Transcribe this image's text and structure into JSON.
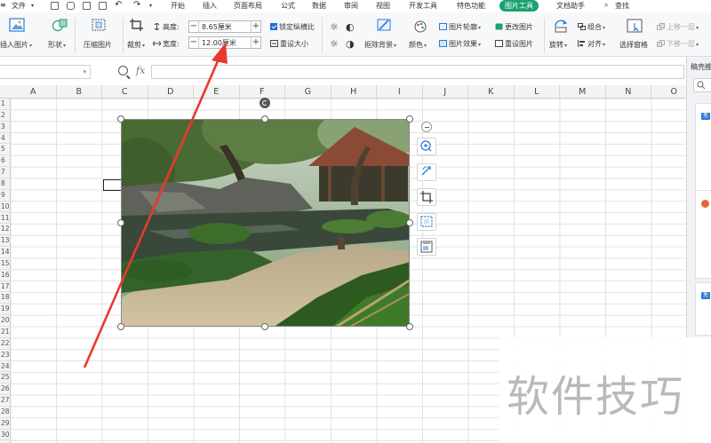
{
  "menubar": {
    "file_label": "文件",
    "tabs": [
      {
        "label": "开始"
      },
      {
        "label": "插入"
      },
      {
        "label": "页面布局"
      },
      {
        "label": "公式"
      },
      {
        "label": "数据"
      },
      {
        "label": "审阅"
      },
      {
        "label": "视图"
      },
      {
        "label": "开发工具"
      },
      {
        "label": "特色功能"
      },
      {
        "label": "图片工具",
        "active": true
      },
      {
        "label": "文档助手"
      }
    ],
    "search_label": "查找"
  },
  "ribbon": {
    "insert_picture": "插入图片",
    "shape": "形状",
    "compress_picture": "压缩图片",
    "crop": "裁剪",
    "height_label": "高度:",
    "height_value": "8.65厘米",
    "width_label": "宽度:",
    "width_value": "12.00厘米",
    "lock_ratio": "锁定纵横比",
    "reset_size": "重设大小",
    "remove_bg": "抠除背景",
    "color": "颜色",
    "picture_outline": "图片轮廓",
    "picture_effect": "图片效果",
    "change_picture": "更改图片",
    "reset_picture": "重设图片",
    "rotate": "旋转",
    "group": "组合",
    "align": "对齐",
    "selection_pane": "选择窗格",
    "move_up": "上移一层",
    "move_down": "下移一层"
  },
  "formula_bar": {
    "fx_label": "fx",
    "cell_value": ""
  },
  "grid": {
    "columns": [
      "A",
      "B",
      "C",
      "D",
      "E",
      "F",
      "G",
      "H",
      "I",
      "J",
      "K",
      "L",
      "M",
      "N",
      "O"
    ],
    "rows": [
      "1",
      "2",
      "3",
      "4",
      "5",
      "6",
      "7",
      "8",
      "9",
      "10",
      "11",
      "12",
      "13",
      "14",
      "15",
      "16",
      "17",
      "18",
      "19",
      "20",
      "21",
      "22",
      "23",
      "24",
      "25",
      "26",
      "27",
      "28",
      "29",
      "30"
    ]
  },
  "right_panel": {
    "title": "稿壳推",
    "badge_label": "免",
    "best_label": "最"
  },
  "watermark": {
    "text": "软件技巧"
  },
  "colors": {
    "accent_green": "#1ca16f",
    "arrow_red": "#e8392f",
    "selection_blue": "#1d6fcf"
  },
  "icons": [
    "search-icon",
    "zoom-in-icon",
    "replace-icon",
    "crop-icon",
    "effects-icon",
    "layout-icon",
    "rotate-handle-icon",
    "collapse-icon"
  ]
}
